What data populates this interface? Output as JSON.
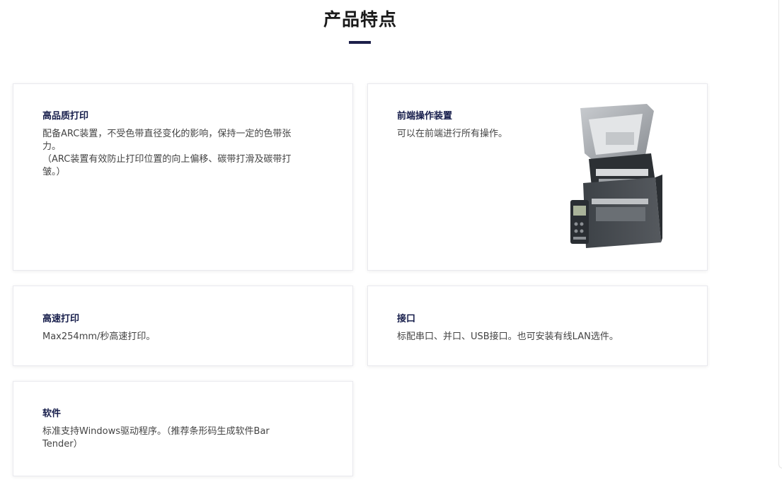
{
  "section": {
    "title": "产品特点"
  },
  "cards": [
    {
      "title": "高品质打印",
      "lines": [
        "配备ARC装置，不受色带直径变化的影响，保持一定的色带张",
        "力。",
        "（ARC装置有效防止打印位置的向上偏移、碳带打滑及碳带打",
        "皱。）"
      ]
    },
    {
      "title": "前端操作装置",
      "lines": [
        "可以在前端进行所有操作。"
      ],
      "image_icon": "printer-icon"
    },
    {
      "title": "高速打印",
      "lines": [
        "Max254mm/秒高速打印。"
      ]
    },
    {
      "title": "接口",
      "lines": [
        "标配串口、并口、USB接口。也可安装有线LAN选件。"
      ]
    },
    {
      "title": "软件",
      "lines": [
        "标准支持Windows驱动程序。（推荐条形码生成软件Bar",
        "Tender）"
      ]
    }
  ],
  "colors": {
    "accent": "#1c1f4a",
    "title_text": "#151c4a",
    "body_text": "#444444"
  }
}
